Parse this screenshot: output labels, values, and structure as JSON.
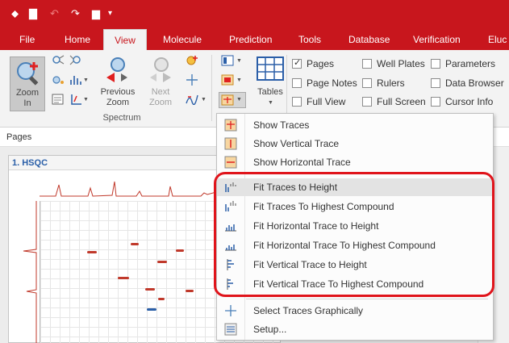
{
  "colors": {
    "accent": "#c8161d",
    "highlight_box": "#e0141b",
    "menu_hover": "#e3e3e3"
  },
  "tabs": [
    {
      "label": "File"
    },
    {
      "label": "Home"
    },
    {
      "label": "View"
    },
    {
      "label": "Molecule"
    },
    {
      "label": "Prediction"
    },
    {
      "label": "Tools"
    },
    {
      "label": "Database"
    },
    {
      "label": "Verification"
    },
    {
      "label": "Eluc"
    }
  ],
  "ribbon": {
    "zoom_in": {
      "line1": "Zoom",
      "line2": "In"
    },
    "previous_zoom": {
      "line1": "Previous",
      "line2": "Zoom"
    },
    "next_zoom": {
      "line1": "Next",
      "line2": "Zoom"
    },
    "spectrum_group": "Spectrum",
    "tables": "Tables",
    "checkboxes": {
      "pages": {
        "label": "Pages",
        "checked": true
      },
      "page_notes": {
        "label": "Page Notes",
        "checked": false
      },
      "full_view": {
        "label": "Full View",
        "checked": false
      },
      "well_plates": {
        "label": "Well Plates",
        "checked": false
      },
      "rulers": {
        "label": "Rulers",
        "checked": false
      },
      "full_screen": {
        "label": "Full Screen",
        "checked": false
      },
      "parameters": {
        "label": "Parameters",
        "checked": false
      },
      "data_browser": {
        "label": "Data Browser",
        "checked": false
      },
      "cursor_info": {
        "label": "Cursor Info",
        "checked": false
      }
    }
  },
  "pages_pane": {
    "title": "Pages",
    "page_label": "1. HSQC"
  },
  "menu": {
    "items": [
      {
        "label": "Show Traces",
        "icon": "show-traces-icon"
      },
      {
        "label": "Show Vertical Trace",
        "icon": "show-vertical-trace-icon"
      },
      {
        "label": "Show Horizontal Trace",
        "icon": "show-horizontal-trace-icon"
      },
      {
        "label": "Fit Traces to Height",
        "icon": "fit-traces-height-icon",
        "highlighted": true
      },
      {
        "label": "Fit Traces To Highest Compound",
        "icon": "fit-traces-compound-icon"
      },
      {
        "label": "Fit Horizontal Trace to Height",
        "icon": "fit-horizontal-height-icon"
      },
      {
        "label": "Fit Horizontal Trace To Highest Compound",
        "icon": "fit-horizontal-compound-icon"
      },
      {
        "label": "Fit Vertical Trace to Height",
        "icon": "fit-vertical-height-icon"
      },
      {
        "label": "Fit Vertical Trace To Highest Compound",
        "icon": "fit-vertical-compound-icon"
      },
      {
        "label": "Select Traces Graphically",
        "icon": "crosshair-icon"
      },
      {
        "label": "Setup...",
        "icon": "setup-icon"
      }
    ]
  }
}
